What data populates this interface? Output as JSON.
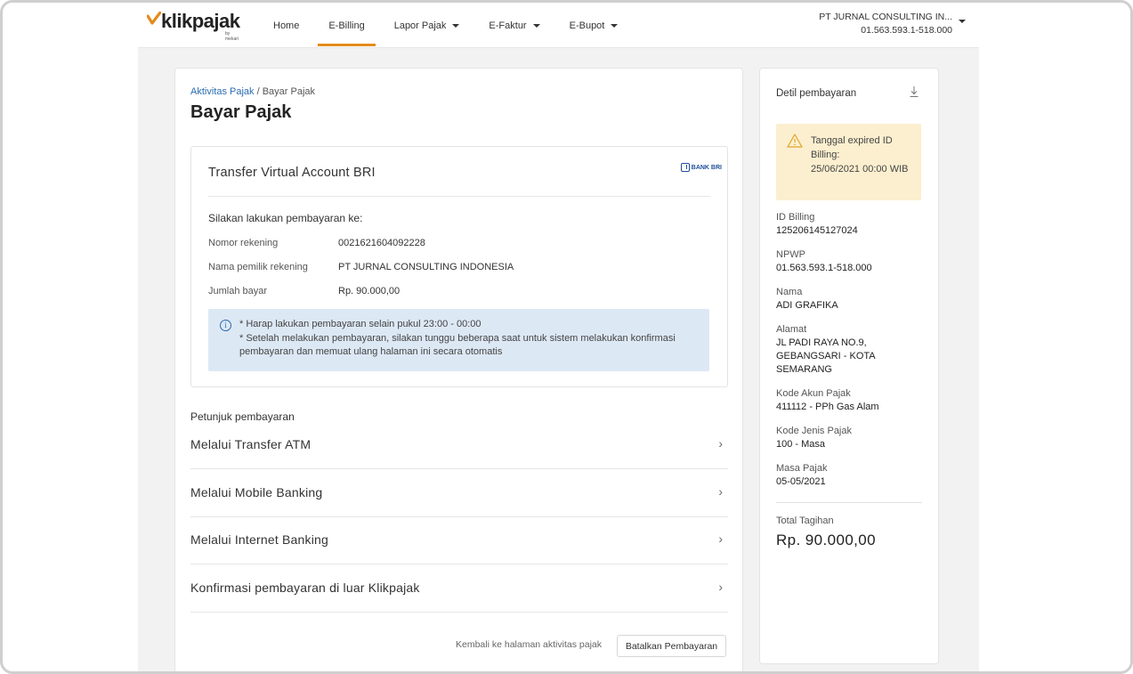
{
  "brand": {
    "name": "klikpajak",
    "sub": "by mekari",
    "accent": "#e38b1c"
  },
  "nav": [
    {
      "label": "Home",
      "dropdown": false,
      "active": false
    },
    {
      "label": "E-Billing",
      "dropdown": false,
      "active": true
    },
    {
      "label": "Lapor Pajak",
      "dropdown": true,
      "active": false
    },
    {
      "label": "E-Faktur",
      "dropdown": true,
      "active": false
    },
    {
      "label": "E-Bupot",
      "dropdown": true,
      "active": false
    }
  ],
  "company": {
    "name": "PT JURNAL CONSULTING IN...",
    "npwp": "01.563.593.1-518.000"
  },
  "breadcrumb": {
    "parent": "Aktivitas Pajak",
    "separator": " / ",
    "current": "Bayar Pajak"
  },
  "page_title": "Bayar Pajak",
  "va": {
    "title": "Transfer Virtual Account BRI",
    "bank_logo_text": "BANK BRI",
    "instruction": "Silakan lakukan pembayaran ke:",
    "rows": [
      {
        "label": "Nomor rekening",
        "value": "0021621604092228"
      },
      {
        "label": "Nama pemilik rekening",
        "value": "PT JURNAL CONSULTING INDONESIA"
      },
      {
        "label": "Jumlah bayar",
        "value": "Rp. 90.000,00"
      }
    ],
    "info": [
      "* Harap lakukan pembayaran selain pukul 23:00 - 00:00",
      "* Setelah melakukan pembayaran, silakan tunggu beberapa saat untuk sistem melakukan konfirmasi pembayaran dan memuat ulang halaman ini secara otomatis"
    ]
  },
  "guide": {
    "title": "Petunjuk pembayaran",
    "items": [
      "Melalui Transfer ATM",
      "Melalui Mobile Banking",
      "Melalui Internet Banking",
      "Konfirmasi pembayaran di luar Klikpajak"
    ]
  },
  "actions": {
    "back_label": "Kembali ke halaman aktivitas pajak",
    "cancel_label": "Batalkan Pembayaran"
  },
  "side": {
    "title": "Detil pembayaran",
    "warning": {
      "line1": "Tanggal expired ID Billing:",
      "line2": "25/06/2021 00:00 WIB"
    },
    "details": [
      {
        "label": "ID Billing",
        "value": "125206145127024"
      },
      {
        "label": "NPWP",
        "value": "01.563.593.1-518.000"
      },
      {
        "label": "Nama",
        "value": "ADI GRAFIKA"
      },
      {
        "label": "Alamat",
        "value": "JL PADI RAYA NO.9, GEBANGSARI - KOTA SEMARANG"
      },
      {
        "label": "Kode Akun Pajak",
        "value": "411112 - PPh Gas Alam"
      },
      {
        "label": "Kode Jenis Pajak",
        "value": "100 - Masa"
      },
      {
        "label": "Masa Pajak",
        "value": "05-05/2021"
      }
    ],
    "total_label": "Total Tagihan",
    "total_value": "Rp. 90.000,00"
  }
}
